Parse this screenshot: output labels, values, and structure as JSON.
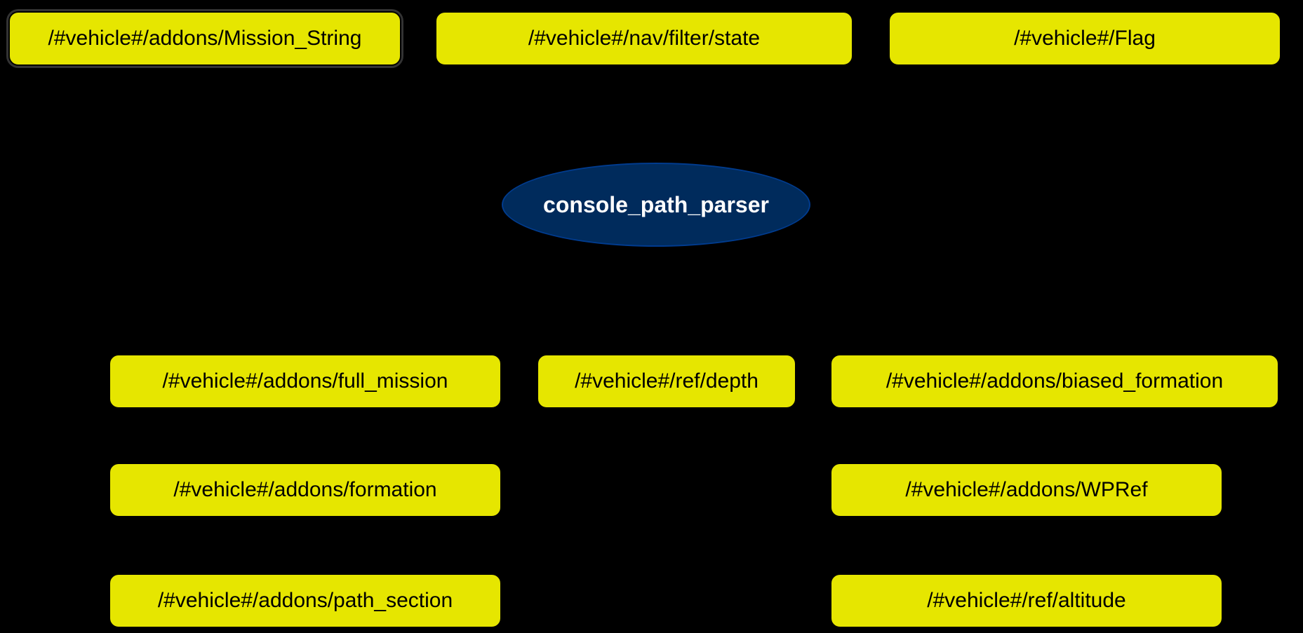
{
  "center": {
    "label": "console_path_parser"
  },
  "top": {
    "n1": "/#vehicle#/addons/Mission_String",
    "n2": "/#vehicle#/nav/filter/state",
    "n3": "/#vehicle#/Flag"
  },
  "bottom": {
    "b1": "/#vehicle#/addons/full_mission",
    "b2": "/#vehicle#/ref/depth",
    "b3": "/#vehicle#/addons/biased_formation",
    "b4": "/#vehicle#/addons/formation",
    "b5": "/#vehicle#/addons/WPRef",
    "b6": "/#vehicle#/addons/path_section",
    "b7": "/#vehicle#/ref/altitude"
  }
}
